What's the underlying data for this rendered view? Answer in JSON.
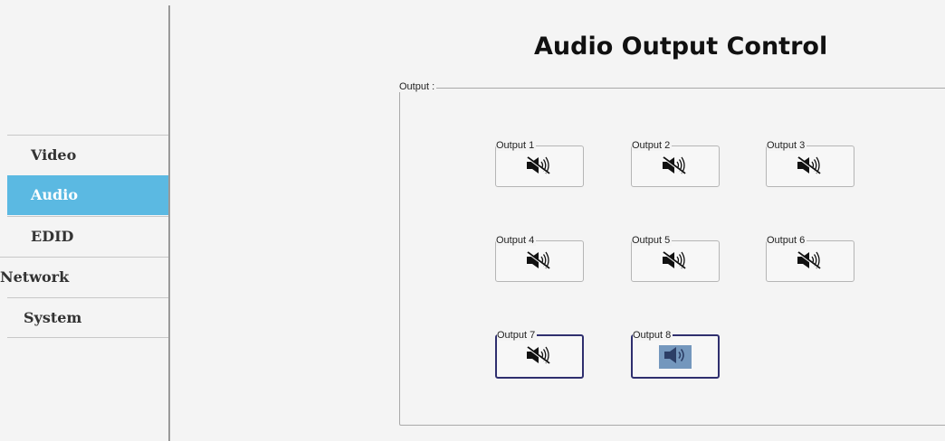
{
  "sidebar": {
    "items": [
      {
        "label": "Video",
        "active": false
      },
      {
        "label": "Audio",
        "active": true
      },
      {
        "label": "EDID",
        "active": false
      },
      {
        "label": "Network",
        "active": false
      },
      {
        "label": "System",
        "active": false
      }
    ]
  },
  "page": {
    "title": "Audio Output Control"
  },
  "output_group": {
    "legend": "Output :",
    "outputs": [
      {
        "label": "Output 1",
        "state": "muted",
        "icon": "speaker-muted-icon"
      },
      {
        "label": "Output 2",
        "state": "muted",
        "icon": "speaker-muted-icon"
      },
      {
        "label": "Output 3",
        "state": "muted",
        "icon": "speaker-muted-icon"
      },
      {
        "label": "Output 4",
        "state": "muted",
        "icon": "speaker-muted-icon"
      },
      {
        "label": "Output 5",
        "state": "muted",
        "icon": "speaker-muted-icon"
      },
      {
        "label": "Output 6",
        "state": "muted",
        "icon": "speaker-muted-icon"
      },
      {
        "label": "Output 7",
        "state": "muted",
        "icon": "speaker-muted-icon"
      },
      {
        "label": "Output 8",
        "state": "on",
        "icon": "speaker-on-icon"
      }
    ]
  },
  "colors": {
    "accent": "#5bb9e2",
    "selected_border": "#2f2f6e",
    "active_button": "#7497bd"
  }
}
